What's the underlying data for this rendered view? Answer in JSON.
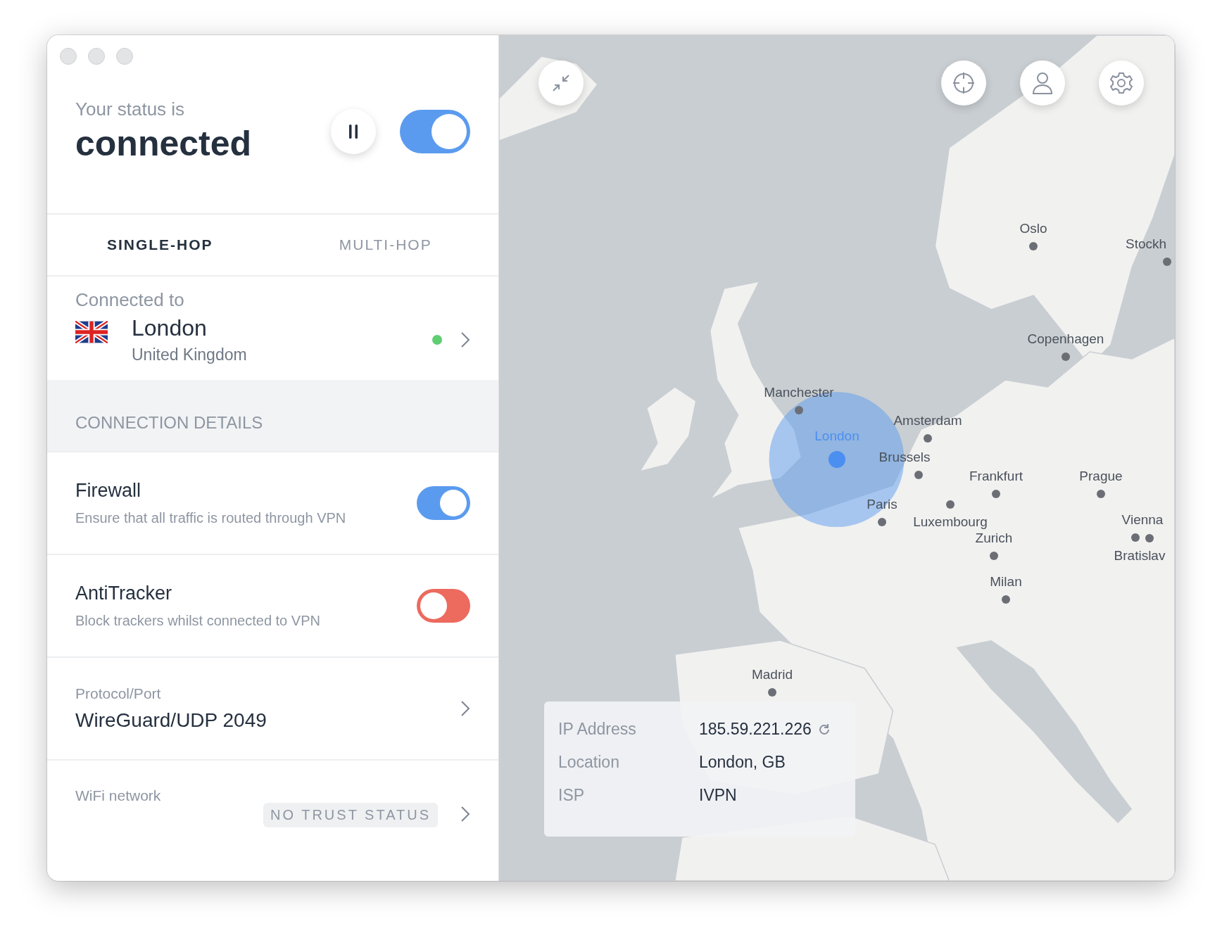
{
  "status": {
    "caption": "Your status is",
    "state": "connected",
    "connected": true
  },
  "tabs": [
    {
      "label": "SINGLE-HOP",
      "selected": true
    },
    {
      "label": "MULTI-HOP",
      "selected": false
    }
  ],
  "server": {
    "caption": "Connected to",
    "city": "London",
    "country": "United Kingdom"
  },
  "details": {
    "heading": "CONNECTION DETAILS",
    "items": [
      {
        "kind": "toggle",
        "title": "Firewall",
        "description": "Ensure that all traffic is routed through VPN",
        "on": true
      },
      {
        "kind": "toggle",
        "title": "AntiTracker",
        "description": "Block trackers whilst connected to VPN",
        "on": false
      },
      {
        "kind": "link",
        "caption": "Protocol/Port",
        "value": "WireGuard/UDP 2049"
      },
      {
        "kind": "badge",
        "caption": "WiFi network",
        "badge": "NO TRUST STATUS"
      }
    ]
  },
  "map": {
    "cities": [
      {
        "name": "Oslo",
        "selected": false
      },
      {
        "name": "Stockh",
        "selected": false
      },
      {
        "name": "Copenhagen",
        "selected": false
      },
      {
        "name": "Manchester",
        "selected": false
      },
      {
        "name": "London",
        "selected": true
      },
      {
        "name": "Amsterdam",
        "selected": false
      },
      {
        "name": "Brussels",
        "selected": false
      },
      {
        "name": "Frankfurt",
        "selected": false
      },
      {
        "name": "Prague",
        "selected": false
      },
      {
        "name": "Paris",
        "selected": false
      },
      {
        "name": "Luxembourg",
        "selected": false
      },
      {
        "name": "Vienna",
        "selected": false
      },
      {
        "name": "Zurich",
        "selected": false
      },
      {
        "name": "Bratislav",
        "selected": false
      },
      {
        "name": "Milan",
        "selected": false
      },
      {
        "name": "Madrid",
        "selected": false
      }
    ]
  },
  "info": [
    {
      "label": "IP Address",
      "value": "185.59.221.226",
      "refresh": true
    },
    {
      "label": "Location",
      "value": "London, GB"
    },
    {
      "label": "ISP",
      "value": "IVPN"
    }
  ]
}
